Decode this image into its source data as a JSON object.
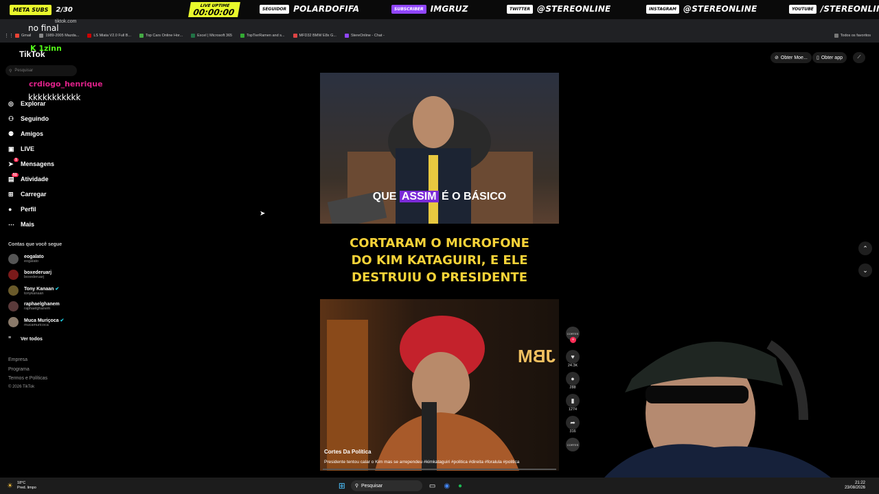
{
  "overlay": {
    "goal_label": "META SUBS",
    "goal_count": "2/30",
    "uptime_label": "LIVE UPTIME",
    "uptime_value": "00:00:00",
    "socials": [
      {
        "tag": "SEGUIDOR",
        "value": "POLARDOFIFA"
      },
      {
        "tag": "SUBSCRIBER",
        "value": "IMGRUZ"
      },
      {
        "tag": "TWITTER",
        "value": "@STEREONLINE"
      },
      {
        "tag": "INSTAGRAM",
        "value": "@STEREONLINE"
      },
      {
        "tag": "YOUTUBE",
        "value": "/STEREONLINE"
      }
    ]
  },
  "browser": {
    "url": "tiktok.com",
    "bookmarks": [
      "Gmail",
      "1989-2005 Mazda...",
      "LS Miata V2.0 Full B...",
      "Top Cars Online Hor...",
      "Excel | Microsoft 365",
      "TopTierRamen and s...",
      "MFD32 BMW E8x G...",
      "StereOnline - Chat -"
    ],
    "bookmarks_all": "Todos os favoritos"
  },
  "sidebar": {
    "logo": "TikTok",
    "search_placeholder": "Pesquisar",
    "nav": [
      "Explorar",
      "Seguindo",
      "Amigos",
      "LIVE",
      "Mensagens",
      "Atividade",
      "Carregar",
      "Perfil",
      "Mais"
    ],
    "badges": {
      "mensagens": "1",
      "atividade": "51"
    },
    "following_title": "Contas que você segue",
    "following": [
      {
        "name": "eogalato",
        "handle": "eogalato"
      },
      {
        "name": "boxederuarj",
        "handle": "boxederuarj"
      },
      {
        "name": "Tony Kanaan",
        "handle": "tonykanaan"
      },
      {
        "name": "raphaelghanem",
        "handle": "raphaelghanem"
      },
      {
        "name": "Muca Muriçoca",
        "handle": "mucamuricoca"
      }
    ],
    "see_all": "Ver todos",
    "footer": [
      "Empresa",
      "Programa",
      "Termos e Políticas",
      "© 2026 TikTok"
    ]
  },
  "header": {
    "obter_moedas": "Obter Moe...",
    "obter_app": "Obter app"
  },
  "video": {
    "subtitle_pre": "QUE",
    "subtitle_hl": "ASSIM",
    "subtitle_post": "É O BÁSICO",
    "headline": [
      "CORTARAM O MICROFONE",
      "DO KIM KATAGUIRI, E ELE",
      "DESTRUIU O PRESIDENTE"
    ],
    "sign": "JBM",
    "author": "Cortes Da Política",
    "caption": "Presidente tentou calar o Kim mas se arrependeu #kimkataguiri #politica #direita #foralula #politica",
    "likes": "24.3K",
    "comments": "288",
    "saves": "1274",
    "shares": "316",
    "channel_badge": "CORTES"
  },
  "chat": [
    {
      "user": "",
      "text": "no final"
    },
    {
      "user": "1zinn",
      "text": ""
    },
    {
      "user": "crdiogo_henrique",
      "text": "kkkkkkkkkkk"
    }
  ],
  "taskbar": {
    "weather_temp": "18°C",
    "weather_desc": "Pred. limpo",
    "search": "Pesquisar",
    "time": "21:22",
    "date": "23/08/2026"
  },
  "colors": {
    "accent_yellow": "#e9f92c",
    "tiktok_red": "#fe2c55",
    "headline_yellow": "#f7d338",
    "twitch_purple": "#9146ff"
  }
}
